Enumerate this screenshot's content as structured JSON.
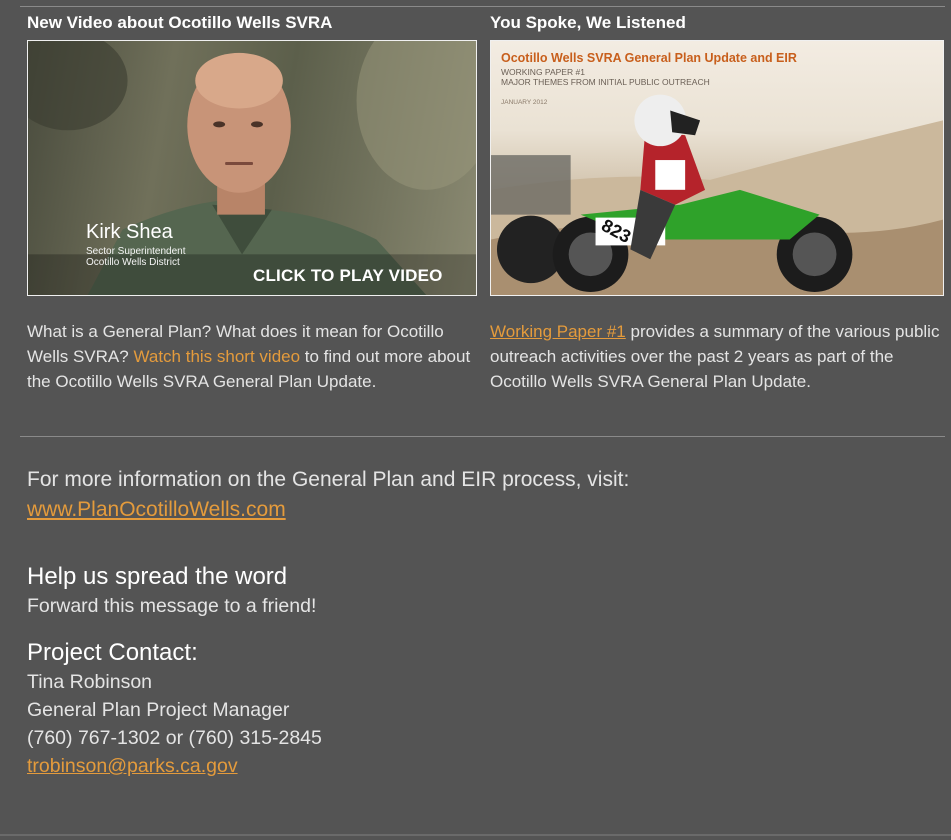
{
  "left_column": {
    "heading": "New Video about Ocotillo Wells SVRA",
    "video": {
      "person_name": "Kirk Shea",
      "person_title_line1": "Sector Superintendent",
      "person_title_line2": "Ocotillo Wells District",
      "play_label": "CLICK TO PLAY VIDEO"
    },
    "text_before": "What is a General Plan? What does it mean for Ocotillo Wells SVRA? ",
    "link_text": "Watch this short video",
    "text_after": " to find out more about the Ocotillo Wells SVRA General Plan Update."
  },
  "right_column": {
    "heading": "You Spoke, We Listened",
    "paper": {
      "title": "Ocotillo Wells SVRA General Plan Update and EIR",
      "subtitle_line1": "WORKING PAPER #1",
      "subtitle_line2": "MAJOR THEMES FROM INITIAL PUBLIC OUTREACH",
      "date": "JANUARY 2012",
      "bike_number": "823"
    },
    "link_text": "Working Paper #1",
    "text_after": " provides a summary of the various public outreach activities over the past 2 years as part of the Ocotillo Wells SVRA General Plan Update."
  },
  "more_info": {
    "text": "For more information on the General Plan and EIR process, visit:",
    "link": "www.PlanOcotilloWells.com"
  },
  "spread": {
    "title": "Help us spread the word",
    "forward_text": "Forward this message to a friend!"
  },
  "contact": {
    "title": "Project Contact:",
    "name": "Tina Robinson",
    "role": "General Plan Project Manager",
    "phone": "(760) 767-1302 or (760) 315-2845",
    "email": "trobinson@parks.ca.gov"
  },
  "colors": {
    "background": "#545454",
    "link": "#e49b3c",
    "text": "#e4e4e4"
  }
}
